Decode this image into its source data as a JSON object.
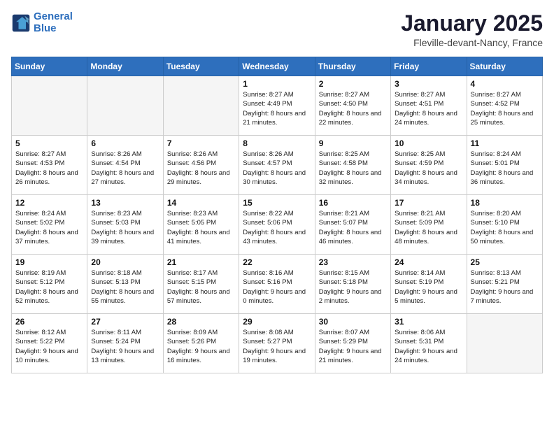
{
  "header": {
    "logo_line1": "General",
    "logo_line2": "Blue",
    "month": "January 2025",
    "location": "Fleville-devant-Nancy, France"
  },
  "weekdays": [
    "Sunday",
    "Monday",
    "Tuesday",
    "Wednesday",
    "Thursday",
    "Friday",
    "Saturday"
  ],
  "weeks": [
    [
      {
        "day": "",
        "info": ""
      },
      {
        "day": "",
        "info": ""
      },
      {
        "day": "",
        "info": ""
      },
      {
        "day": "1",
        "info": "Sunrise: 8:27 AM\nSunset: 4:49 PM\nDaylight: 8 hours and 21 minutes."
      },
      {
        "day": "2",
        "info": "Sunrise: 8:27 AM\nSunset: 4:50 PM\nDaylight: 8 hours and 22 minutes."
      },
      {
        "day": "3",
        "info": "Sunrise: 8:27 AM\nSunset: 4:51 PM\nDaylight: 8 hours and 24 minutes."
      },
      {
        "day": "4",
        "info": "Sunrise: 8:27 AM\nSunset: 4:52 PM\nDaylight: 8 hours and 25 minutes."
      }
    ],
    [
      {
        "day": "5",
        "info": "Sunrise: 8:27 AM\nSunset: 4:53 PM\nDaylight: 8 hours and 26 minutes."
      },
      {
        "day": "6",
        "info": "Sunrise: 8:26 AM\nSunset: 4:54 PM\nDaylight: 8 hours and 27 minutes."
      },
      {
        "day": "7",
        "info": "Sunrise: 8:26 AM\nSunset: 4:56 PM\nDaylight: 8 hours and 29 minutes."
      },
      {
        "day": "8",
        "info": "Sunrise: 8:26 AM\nSunset: 4:57 PM\nDaylight: 8 hours and 30 minutes."
      },
      {
        "day": "9",
        "info": "Sunrise: 8:25 AM\nSunset: 4:58 PM\nDaylight: 8 hours and 32 minutes."
      },
      {
        "day": "10",
        "info": "Sunrise: 8:25 AM\nSunset: 4:59 PM\nDaylight: 8 hours and 34 minutes."
      },
      {
        "day": "11",
        "info": "Sunrise: 8:24 AM\nSunset: 5:01 PM\nDaylight: 8 hours and 36 minutes."
      }
    ],
    [
      {
        "day": "12",
        "info": "Sunrise: 8:24 AM\nSunset: 5:02 PM\nDaylight: 8 hours and 37 minutes."
      },
      {
        "day": "13",
        "info": "Sunrise: 8:23 AM\nSunset: 5:03 PM\nDaylight: 8 hours and 39 minutes."
      },
      {
        "day": "14",
        "info": "Sunrise: 8:23 AM\nSunset: 5:05 PM\nDaylight: 8 hours and 41 minutes."
      },
      {
        "day": "15",
        "info": "Sunrise: 8:22 AM\nSunset: 5:06 PM\nDaylight: 8 hours and 43 minutes."
      },
      {
        "day": "16",
        "info": "Sunrise: 8:21 AM\nSunset: 5:07 PM\nDaylight: 8 hours and 46 minutes."
      },
      {
        "day": "17",
        "info": "Sunrise: 8:21 AM\nSunset: 5:09 PM\nDaylight: 8 hours and 48 minutes."
      },
      {
        "day": "18",
        "info": "Sunrise: 8:20 AM\nSunset: 5:10 PM\nDaylight: 8 hours and 50 minutes."
      }
    ],
    [
      {
        "day": "19",
        "info": "Sunrise: 8:19 AM\nSunset: 5:12 PM\nDaylight: 8 hours and 52 minutes."
      },
      {
        "day": "20",
        "info": "Sunrise: 8:18 AM\nSunset: 5:13 PM\nDaylight: 8 hours and 55 minutes."
      },
      {
        "day": "21",
        "info": "Sunrise: 8:17 AM\nSunset: 5:15 PM\nDaylight: 8 hours and 57 minutes."
      },
      {
        "day": "22",
        "info": "Sunrise: 8:16 AM\nSunset: 5:16 PM\nDaylight: 9 hours and 0 minutes."
      },
      {
        "day": "23",
        "info": "Sunrise: 8:15 AM\nSunset: 5:18 PM\nDaylight: 9 hours and 2 minutes."
      },
      {
        "day": "24",
        "info": "Sunrise: 8:14 AM\nSunset: 5:19 PM\nDaylight: 9 hours and 5 minutes."
      },
      {
        "day": "25",
        "info": "Sunrise: 8:13 AM\nSunset: 5:21 PM\nDaylight: 9 hours and 7 minutes."
      }
    ],
    [
      {
        "day": "26",
        "info": "Sunrise: 8:12 AM\nSunset: 5:22 PM\nDaylight: 9 hours and 10 minutes."
      },
      {
        "day": "27",
        "info": "Sunrise: 8:11 AM\nSunset: 5:24 PM\nDaylight: 9 hours and 13 minutes."
      },
      {
        "day": "28",
        "info": "Sunrise: 8:09 AM\nSunset: 5:26 PM\nDaylight: 9 hours and 16 minutes."
      },
      {
        "day": "29",
        "info": "Sunrise: 8:08 AM\nSunset: 5:27 PM\nDaylight: 9 hours and 19 minutes."
      },
      {
        "day": "30",
        "info": "Sunrise: 8:07 AM\nSunset: 5:29 PM\nDaylight: 9 hours and 21 minutes."
      },
      {
        "day": "31",
        "info": "Sunrise: 8:06 AM\nSunset: 5:31 PM\nDaylight: 9 hours and 24 minutes."
      },
      {
        "day": "",
        "info": ""
      }
    ]
  ]
}
